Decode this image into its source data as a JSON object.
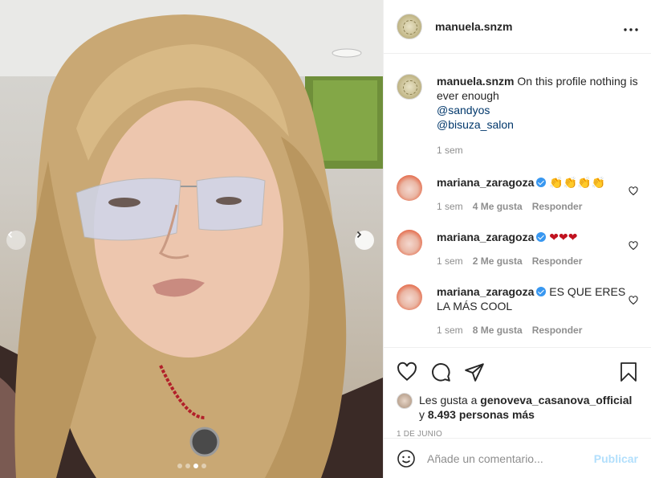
{
  "post": {
    "username": "manuela.snzm",
    "caption_text": "On this profile nothing is ever enough",
    "mentions": [
      "@sandyos",
      "@bisuza_salon"
    ],
    "caption_age": "1 sem",
    "more_icon": "more-horizontal-icon"
  },
  "photo": {
    "prev_icon": "chevron-left-icon",
    "next_icon": "chevron-right-icon",
    "dots_count": 4,
    "active_dot": 3
  },
  "comments": [
    {
      "user": "mariana_zaragoza",
      "verified": true,
      "text": "👏👏👏👏",
      "age": "1 sem",
      "likes": "4 Me gusta",
      "reply": "Responder"
    },
    {
      "user": "mariana_zaragoza",
      "verified": true,
      "text": "❤❤❤",
      "age": "1 sem",
      "likes": "2 Me gusta",
      "reply": "Responder"
    },
    {
      "user": "mariana_zaragoza",
      "verified": true,
      "text": "ES QUE ERES LA MÁS COOL",
      "age": "1 sem",
      "likes": "8 Me gusta",
      "reply": "Responder"
    }
  ],
  "likes": {
    "prefix": "Les gusta a",
    "user": "genoveva_casanova_official",
    "conj": "y",
    "others": "8.493 personas más"
  },
  "date": "1 DE JUNIO",
  "composer": {
    "placeholder": "Añade un comentario...",
    "publish": "Publicar"
  },
  "colors": {
    "verified": "#3897f0",
    "link": "#00376b",
    "muted": "#8e8e8e",
    "publish_disabled": "#b2dffc"
  }
}
